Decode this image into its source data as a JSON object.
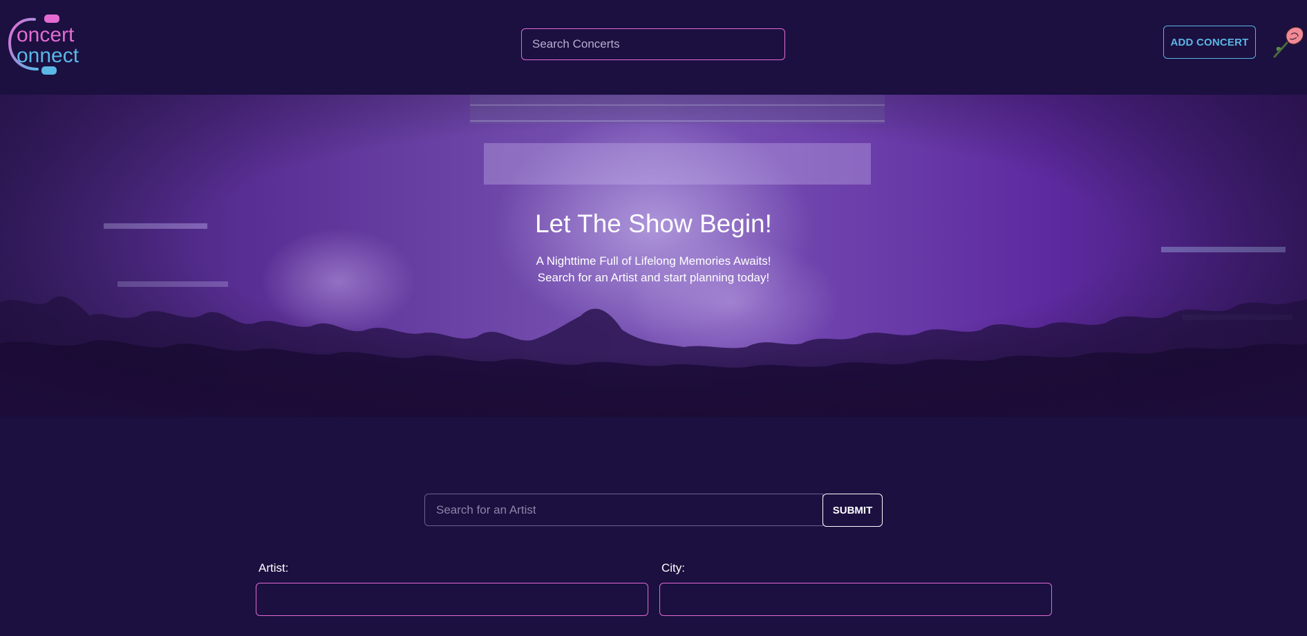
{
  "navbar": {
    "logo_text_line1": "oncert",
    "logo_text_line2": "onnect",
    "search_placeholder": "Search Concerts",
    "add_concert_label": "ADD CONCERT",
    "avatar_icon": "rose-icon"
  },
  "hero": {
    "title": "Let The Show Begin!",
    "subtitle_line1": "A Nighttime Full of Lifelong Memories Awaits!",
    "subtitle_line2": "Search for an Artist and start planning today!"
  },
  "artist_search": {
    "placeholder": "Search for an Artist",
    "submit_label": "SUBMIT"
  },
  "form": {
    "artist_label": "Artist:",
    "artist_value": "",
    "city_label": "City:",
    "city_value": ""
  },
  "colors": {
    "background": "#1b1040",
    "accent_pink": "#e56bd3",
    "accent_blue": "#5bb7e6"
  }
}
